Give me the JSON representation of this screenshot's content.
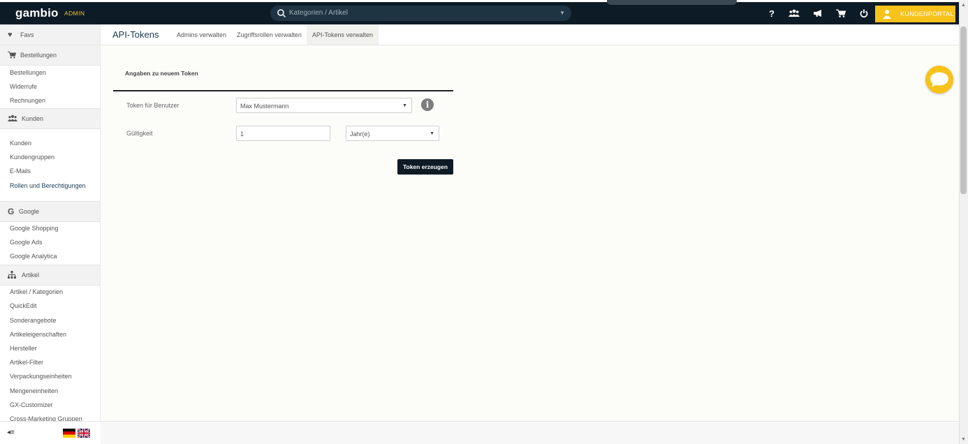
{
  "topbar": {
    "logo": "gambio",
    "logo_suffix": "ADMIN",
    "search_placeholder": "Kategorien / Artikel",
    "customer_portal": "KUNDENPORTAL",
    "icons": [
      "question-icon",
      "users-icon",
      "megaphone-icon",
      "cart-icon",
      "power-icon",
      "user-icon"
    ]
  },
  "sidebar": {
    "favs": "Favs",
    "bestellungen": {
      "title": "Bestellungen",
      "items": [
        "Bestellungen",
        "Widerrufe",
        "Rechnungen"
      ]
    },
    "kunden": {
      "title": "Kunden",
      "items": [
        "Kunden",
        "Kundengruppen",
        "E-Mails",
        "Rollen und Berechtigungen"
      ]
    },
    "google": {
      "title": "Google",
      "items": [
        "Google Shopping",
        "Google Ads",
        "Google Analytica"
      ]
    },
    "artikel": {
      "title": "Artikel",
      "items": [
        "Artikel / Kategorien",
        "QuickEdit",
        "Sonderangebote",
        "Artikeleigenschaften",
        "Hersteller",
        "Artikel-Filter",
        "Verpackungseinheiten",
        "Mengeneinheiten",
        "GX-Customizer",
        "Cross-Marketing Gruppen"
      ]
    }
  },
  "page": {
    "title": "API-Tokens",
    "tabs": [
      "Admins verwalten",
      "Zugriffsrollen verwalten",
      "API-Tokens verwalten"
    ],
    "active_tab": 2
  },
  "form": {
    "section_title": "Angaben zu neuem Token",
    "token_user_label": "Token für Benutzer",
    "token_user_value": "Max Mustermann",
    "validity_label": "Gültigkeit",
    "validity_value": "1",
    "validity_unit": "Jahr(e)",
    "submit_label": "Token erzeugen"
  },
  "colors": {
    "topbar": "#0d1b26",
    "accent": "#f7c21a",
    "button": "#0d1b26"
  }
}
